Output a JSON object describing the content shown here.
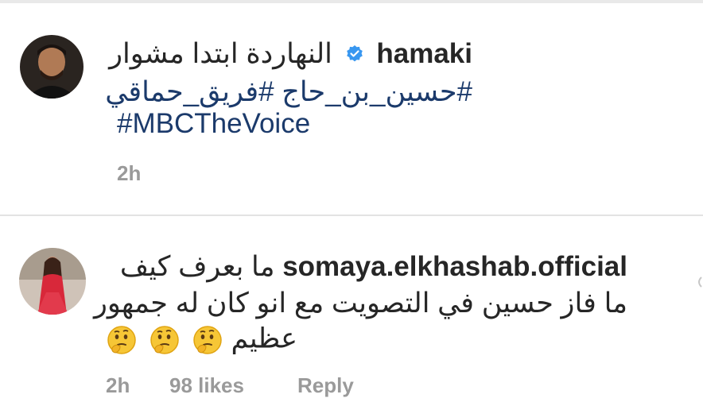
{
  "post": {
    "username": "hamaki",
    "caption": "النهاردة ابتدا مشوار",
    "hashtags_ar": "#حسين_بن_حاج #فريق_حماقي",
    "hashtag_en": "#MBCTheVoice",
    "time": "2h"
  },
  "comment": {
    "username": "somaya.elkhashab.official",
    "line1": "ما بعرف كيف",
    "line2": "ما فاز حسين في التصويت مع انو كان له جمهور",
    "line3": "عظيم",
    "emojis": [
      "thinking-face",
      "thinking-face",
      "thinking-face"
    ],
    "time": "2h",
    "likes": "98 likes",
    "reply": "Reply"
  },
  "colors": {
    "text": "#262626",
    "hashtag": "#1b3a6b",
    "meta": "#9a9a9a",
    "verified": "#3897f0"
  }
}
